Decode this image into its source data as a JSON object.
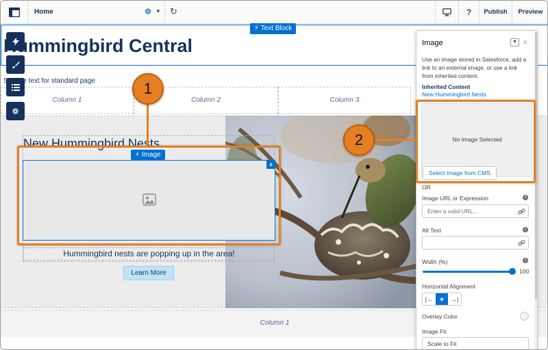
{
  "topbar": {
    "page_name": "Home",
    "publish_label": "Publish",
    "preview_label": "Preview",
    "help_label": "?"
  },
  "canvas": {
    "block_tag_label": "Text Block",
    "main_heading": "Hummingbird Central",
    "intro_text": "Sample text for standard page",
    "columns": [
      "Column 1",
      "Column 2",
      "Column 3"
    ],
    "nest_title": "New Hummingbird Nests",
    "image_tag_label": "Image",
    "image_remove_label": "x",
    "nest_caption": "Hummingbird nests are popping up in the area!",
    "learn_more_label": "Learn More",
    "footer_column_label": "Column 1"
  },
  "callouts": [
    "1",
    "2"
  ],
  "panel": {
    "title": "Image",
    "description": "Use an image stored in Salesforce, add a link to an external image, or use a link from inherited content.",
    "inherited_title": "Inherited Content",
    "inherited_value": "New Hummingbird Nests",
    "preview_text": "No Image Selected",
    "select_button_label": "Select Image from CMS",
    "or_label": "OR",
    "url_label": "Image URL or Expression",
    "url_placeholder": "Enter a valid URL...",
    "alt_label": "Alt Text",
    "alt_value": "",
    "width_label": "Width (%)",
    "width_value": "100",
    "width_fraction": 1.0,
    "alignment_label": "Horizontal Alignment",
    "overlay_label": "Overlay Color",
    "fit_label": "Image Fit",
    "fit_value": "Scale to Fit"
  },
  "colors": {
    "brand_navy": "#16325c",
    "accent_blue": "#0070d2",
    "callout_orange": "#e67e22"
  },
  "icons": {
    "app_switcher": "layout-icon",
    "settings": "gear-icon",
    "refresh": "refresh-icon",
    "device": "monitor-icon",
    "rail": [
      "lightning-icon",
      "brush-icon",
      "list-icon",
      "gear-icon"
    ],
    "image_placeholder": "image-icon",
    "link": "link-icon"
  }
}
